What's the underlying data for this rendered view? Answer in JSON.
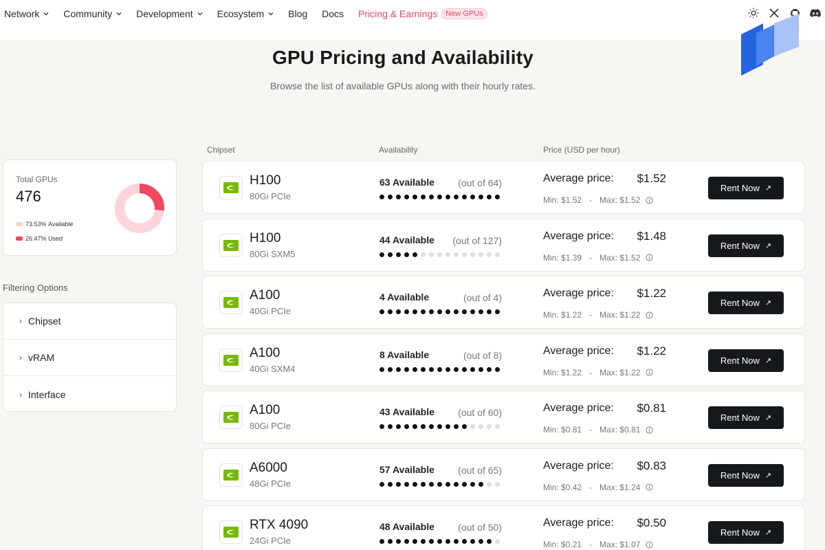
{
  "nav": {
    "items": [
      {
        "label": "Network",
        "dropdown": true
      },
      {
        "label": "Community",
        "dropdown": true
      },
      {
        "label": "Development",
        "dropdown": true
      },
      {
        "label": "Ecosystem",
        "dropdown": true
      },
      {
        "label": "Blog",
        "dropdown": false
      },
      {
        "label": "Docs",
        "dropdown": false
      }
    ],
    "active": {
      "label": "Pricing & Earnings",
      "badge": "New GPUs"
    },
    "icons": [
      "sun-icon",
      "x-twitter-icon",
      "github-icon",
      "discord-icon"
    ],
    "accent": "#e04a5f"
  },
  "hero": {
    "title": "GPU Pricing and Availability",
    "subtitle": "Browse the list of available GPUs along with their hourly rates."
  },
  "summary": {
    "label": "Total GPUs",
    "total": "476",
    "available_pct": "73.53%",
    "available_label": "Available",
    "used_pct": "26.47%",
    "used_label": "Used",
    "available_fraction": 0.7353,
    "used_fraction": 0.2647,
    "available_color": "#fcd5da",
    "used_color": "#f0485f"
  },
  "filters": {
    "title": "Filtering Options",
    "items": [
      "Chipset",
      "vRAM",
      "Interface"
    ]
  },
  "table": {
    "headers": {
      "chipset": "Chipset",
      "availability": "Availability",
      "price": "Price (USD per hour)"
    },
    "avg_label": "Average price:",
    "min_prefix": "Min:",
    "max_prefix": "Max:",
    "separator": "-",
    "rent_label": "Rent Now",
    "rows": [
      {
        "name": "H100",
        "spec": "80Gi PCIe",
        "available_text": "63 Available",
        "outof": "(out of 64)",
        "available": 63,
        "total": 64,
        "avg": "$1.52",
        "min": "$1.52",
        "max": "$1.52"
      },
      {
        "name": "H100",
        "spec": "80Gi SXM5",
        "available_text": "44 Available",
        "outof": "(out of 127)",
        "available": 44,
        "total": 127,
        "avg": "$1.48",
        "min": "$1.39",
        "max": "$1.52"
      },
      {
        "name": "A100",
        "spec": "40Gi PCIe",
        "available_text": "4 Available",
        "outof": "(out of 4)",
        "available": 4,
        "total": 4,
        "avg": "$1.22",
        "min": "$1.22",
        "max": "$1.22"
      },
      {
        "name": "A100",
        "spec": "40Gi SXM4",
        "available_text": "8 Available",
        "outof": "(out of 8)",
        "available": 8,
        "total": 8,
        "avg": "$1.22",
        "min": "$1.22",
        "max": "$1.22"
      },
      {
        "name": "A100",
        "spec": "80Gi PCIe",
        "available_text": "43 Available",
        "outof": "(out of 60)",
        "available": 43,
        "total": 60,
        "avg": "$0.81",
        "min": "$0.81",
        "max": "$0.81"
      },
      {
        "name": "A6000",
        "spec": "48Gi PCIe",
        "available_text": "57 Available",
        "outof": "(out of 65)",
        "available": 57,
        "total": 65,
        "avg": "$0.83",
        "min": "$0.42",
        "max": "$1.24"
      },
      {
        "name": "RTX 4090",
        "spec": "24Gi PCIe",
        "available_text": "48 Available",
        "outof": "(out of 50)",
        "available": 48,
        "total": 50,
        "avg": "$0.50",
        "min": "$0.21",
        "max": "$1.07"
      }
    ]
  }
}
